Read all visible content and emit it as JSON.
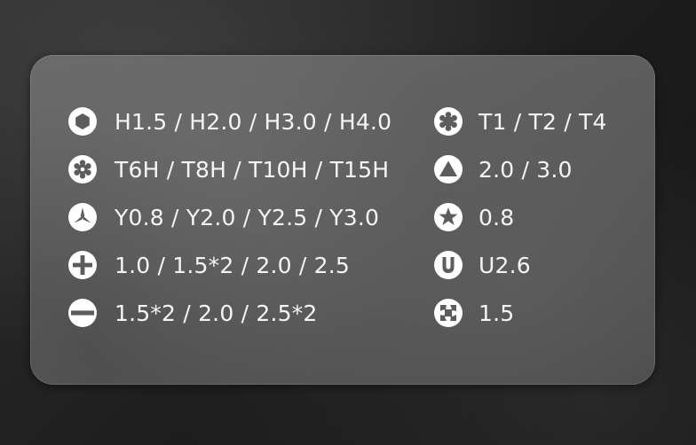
{
  "left_items": [
    {
      "icon": "hex-icon",
      "label": "H1.5 / H2.0 / H3.0 / H4.0"
    },
    {
      "icon": "torx-security-icon",
      "label": "T6H / T8H / T10H / T15H"
    },
    {
      "icon": "tri-wing-icon",
      "label": "Y0.8 / Y2.0 / Y2.5 / Y3.0"
    },
    {
      "icon": "phillips-icon",
      "label": "1.0 / 1.5*2 / 2.0 / 2.5"
    },
    {
      "icon": "slotted-icon",
      "label": "1.5*2 / 2.0 / 2.5*2"
    }
  ],
  "right_items": [
    {
      "icon": "torx-icon",
      "label": "T1 / T2 / T4"
    },
    {
      "icon": "triangle-icon",
      "label": "2.0 / 3.0"
    },
    {
      "icon": "pentalobe-icon",
      "label": "0.8"
    },
    {
      "icon": "u-shape-icon",
      "label": "U2.6"
    },
    {
      "icon": "square-recess-icon",
      "label": "1.5"
    }
  ],
  "colors": {
    "background": "#1d1d1d",
    "panel": "#5e5e5e",
    "text": "#f4f4f4",
    "icon_fill": "#ffffff"
  }
}
